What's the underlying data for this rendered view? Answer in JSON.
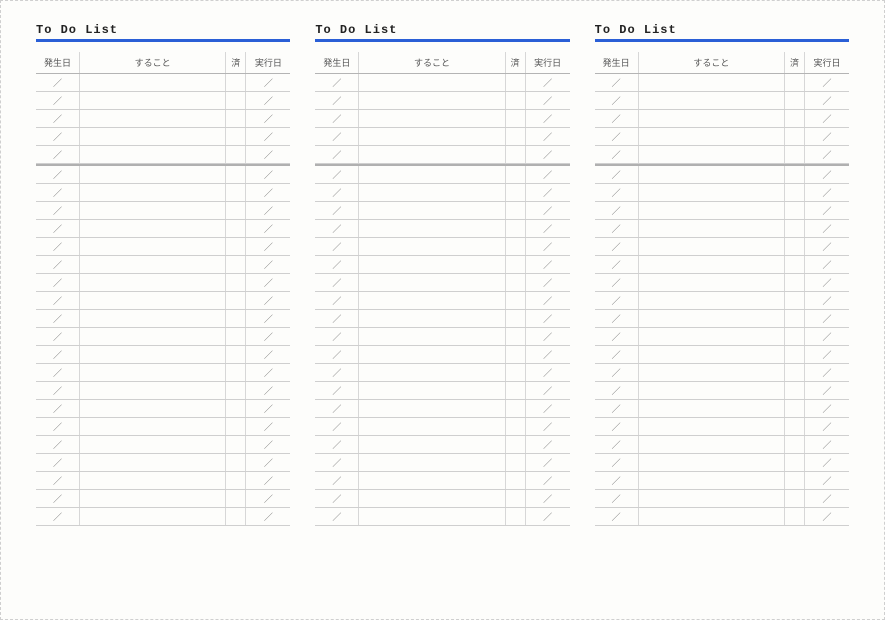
{
  "title": "To Do List",
  "columns": {
    "date1": "発生日",
    "task": "すること",
    "done": "済",
    "date2": "実行日"
  },
  "slash": "／",
  "panels": 3,
  "group1_rows": 5,
  "group2_rows": 20
}
